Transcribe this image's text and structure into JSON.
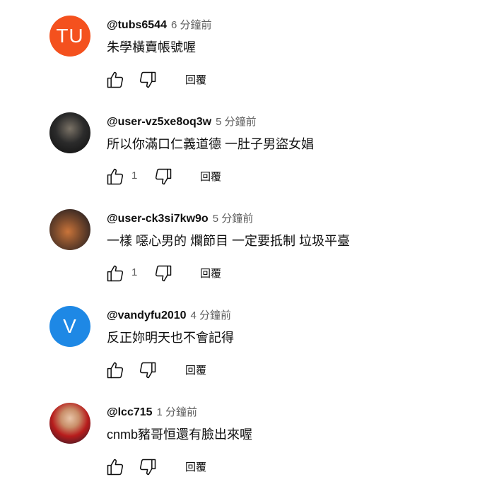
{
  "comments": [
    {
      "handle": "@tubs6544",
      "time": "6 分鐘前",
      "text": "朱學橫賣帳號喔",
      "likes": "",
      "reply_label": "回覆",
      "avatar_initials": "TU",
      "avatar_color": "#f4511e"
    },
    {
      "handle": "@user-vz5xe8oq3w",
      "time": "5 分鐘前",
      "text": "所以你滿口仁義道德 一肚子男盜女娼",
      "likes": "1",
      "reply_label": "回覆",
      "avatar_initials": "",
      "avatar_color": "#2b2b2b"
    },
    {
      "handle": "@user-ck3si7kw9o",
      "time": "5 分鐘前",
      "text": "一樣 噁心男的 爛節目 一定要抵制 垃圾平臺",
      "likes": "1",
      "reply_label": "回覆",
      "avatar_initials": "",
      "avatar_color": "#8a5a3a"
    },
    {
      "handle": "@vandyfu2010",
      "time": "4 分鐘前",
      "text": "反正妳明天也不會記得",
      "likes": "",
      "reply_label": "回覆",
      "avatar_initials": "V",
      "avatar_color": "#1e88e5"
    },
    {
      "handle": "@lcc715",
      "time": "1 分鐘前",
      "text": "cnmb豬哥恒還有臉出來喔",
      "likes": "",
      "reply_label": "回覆",
      "avatar_initials": "",
      "avatar_color": "#b71c1c"
    }
  ]
}
